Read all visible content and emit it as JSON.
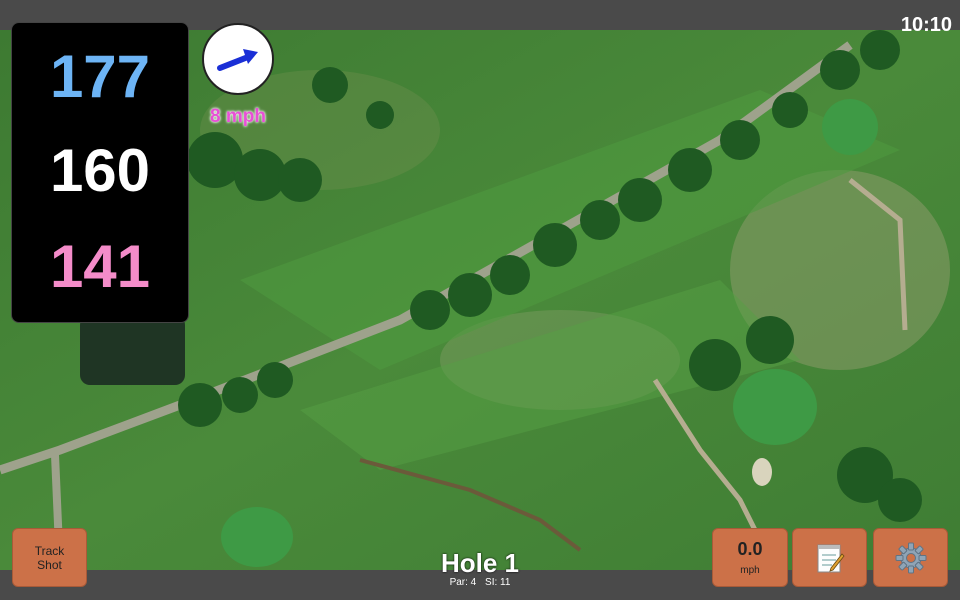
{
  "status": {
    "clock": "10:10"
  },
  "distances": {
    "back": "177",
    "middle": "160",
    "front": "141"
  },
  "wind": {
    "speed": "8 mph",
    "icon": "wind-arrow-icon",
    "arrow_color": "#1a2fd6"
  },
  "hole": {
    "title": "Hole 1",
    "par": "Par: 4",
    "si": "SI: 11"
  },
  "buttons": {
    "track_line1": "Track",
    "track_line2": "Shot",
    "speed_value": "0.0",
    "speed_unit": "mph",
    "notes_icon": "notepad-icon",
    "settings_icon": "gear-icon"
  },
  "colors": {
    "back_distance": "#6db4f5",
    "middle_distance": "#ffffff",
    "front_distance": "#f48cc9",
    "wind_speed": "#e84fd6",
    "button": "#cc7148"
  }
}
